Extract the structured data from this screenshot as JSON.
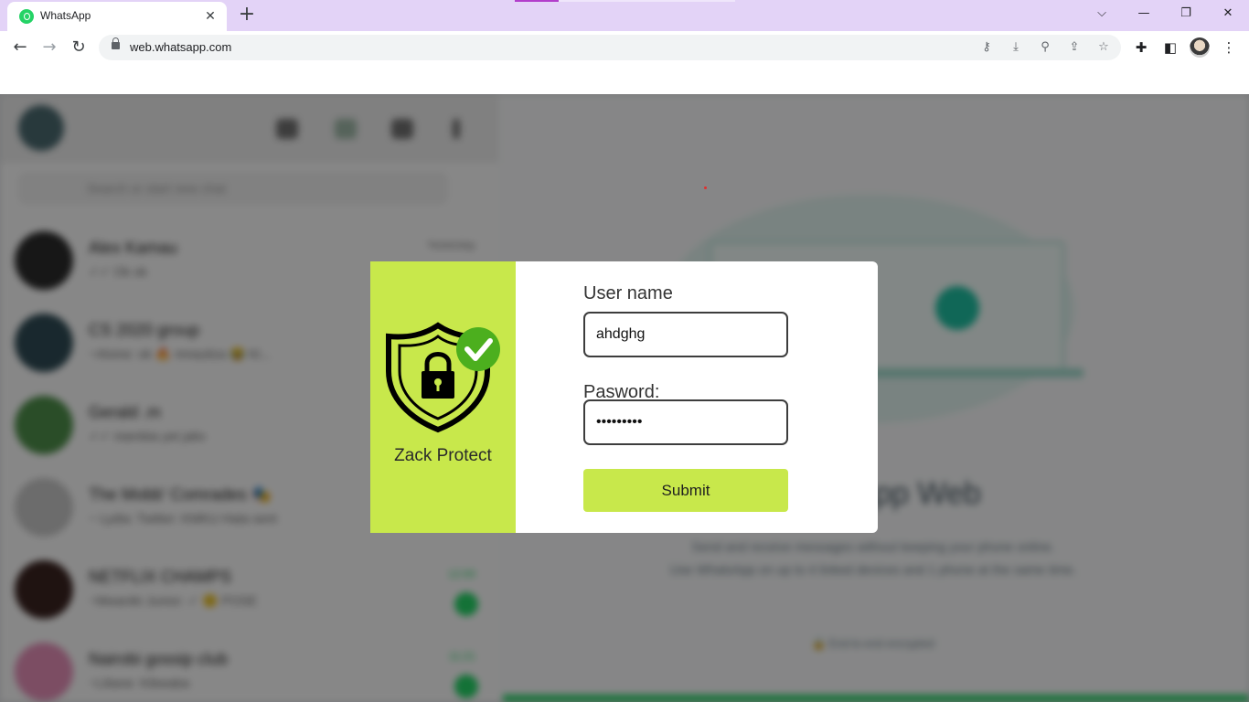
{
  "browser": {
    "tab_title": "WhatsApp",
    "url": "web.whatsapp.com",
    "accent_color": "#e3d3f7"
  },
  "whatsapp": {
    "search_placeholder": "Search or start new chat",
    "chats": [
      {
        "name": "Alex Kamau",
        "preview": "✓✓ Ok ok",
        "time": "Yesterday",
        "unread": "",
        "avatar_color": "#2b2b2b"
      },
      {
        "name": "CS 2020 group",
        "preview": "~Alvine: ok 🔥 mnauliza 😂 Ki...",
        "time": "",
        "unread": "",
        "avatar_color": "#2f4b55"
      },
      {
        "name": "Gerald .m",
        "preview": "✓✓ niambia yet jalio",
        "time": "",
        "unread": "",
        "avatar_color": "#4e8f4a"
      },
      {
        "name": "The Mobb' Comrades 🎭",
        "preview": "~ Lydia: Twitter: KMKU Hata sent",
        "time": "",
        "unread": "",
        "avatar_color": "#c7c7c7"
      },
      {
        "name": "NETFLIX CHAMPS",
        "preview": "~Mwaniki Junior: ✓ 🙂 POSE",
        "time": "12:00",
        "unread": "1",
        "avatar_color": "#3a2320"
      },
      {
        "name": "Nairobi gossip club",
        "preview": "~Liliane: Kibwaba",
        "time": "11:21",
        "unread": "1",
        "avatar_color": "#e58fb8"
      }
    ],
    "intro_title": "WhatsApp Web",
    "intro_line1": "Send and receive messages without keeping your phone online.",
    "intro_line2": "Use WhatsApp on up to 4 linked devices and 1 phone at the same time.",
    "intro_footer": "🔒 End-to-end encrypted"
  },
  "modal": {
    "brand_name": "Zack Protect",
    "brand_color": "#c8e84b",
    "username_label": "User name",
    "username_value": "ahdghg",
    "password_label": "Pasword:",
    "password_value": "•••••••••",
    "submit_label": "Submit"
  }
}
